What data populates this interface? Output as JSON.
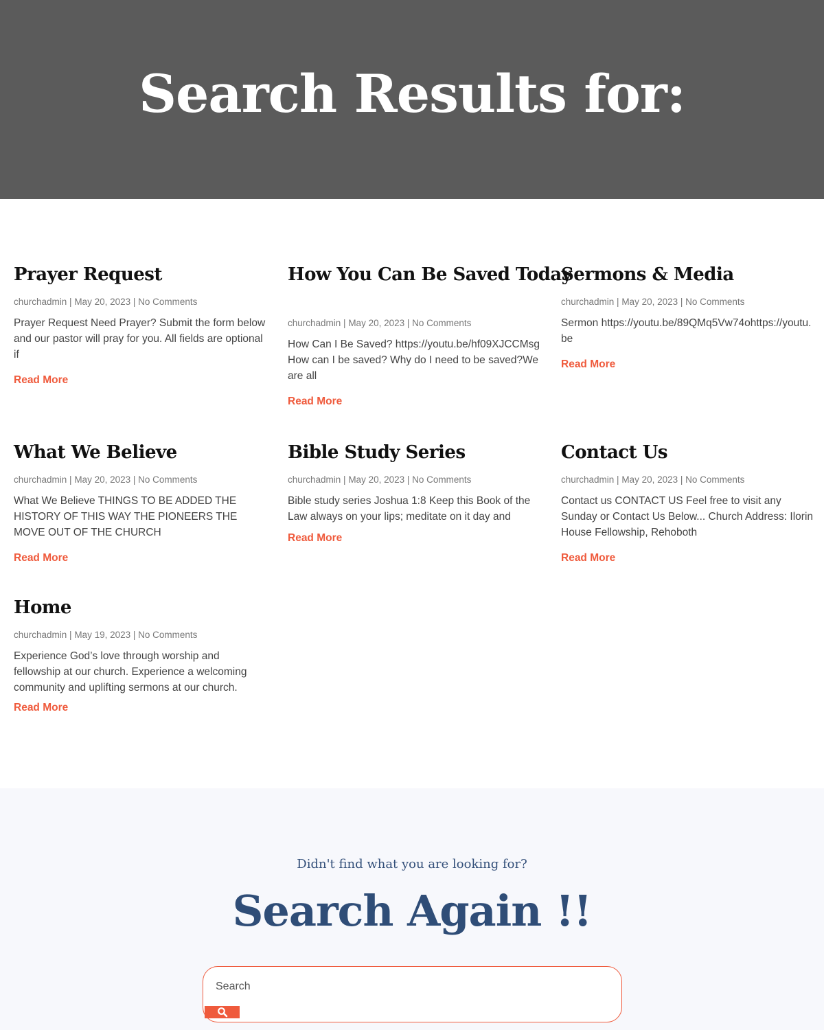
{
  "header": {
    "title": "Search Results for:"
  },
  "posts": [
    {
      "title": "Prayer Request",
      "author": "churchadmin",
      "date": "May 20, 2023",
      "comments": "No Comments",
      "excerpt": "Prayer Request Need Prayer? Submit the form below and our pastor will pray for you. All fields are optional if",
      "read_more": "Read More"
    },
    {
      "title": "How You Can Be Saved Today",
      "author": "churchadmin",
      "date": "May 20, 2023",
      "comments": "No Comments",
      "excerpt": "How Can I Be Saved? https://youtu.be/hf09XJCCMsg How can I be saved? Why do I need to be saved?We are all",
      "read_more": "Read More"
    },
    {
      "title": "Sermons & Media",
      "author": "churchadmin",
      "date": "May 20, 2023",
      "comments": "No Comments",
      "excerpt": "Sermon https://youtu.be/89QMq5Vw74ohttps://youtu.be",
      "read_more": "Read More"
    },
    {
      "title": "What We Believe",
      "author": "churchadmin",
      "date": "May 20, 2023",
      "comments": "No Comments",
      "excerpt": "What We Believe THINGS TO BE ADDED THE HISTORY OF THIS WAY THE PIONEERS THE MOVE OUT OF THE CHURCH",
      "read_more": "Read More"
    },
    {
      "title": "Bible Study Series",
      "author": "churchadmin",
      "date": "May 20, 2023",
      "comments": "No Comments",
      "excerpt": "Bible study series Joshua 1:8 Keep this Book of the Law always on your lips; meditate on it day and",
      "read_more": "Read More"
    },
    {
      "title": "Contact Us",
      "author": "churchadmin",
      "date": "May 20, 2023",
      "comments": "No Comments",
      "excerpt": "Contact us CONTACT US Feel free to visit any Sunday or Contact Us Below... Church Address: Ilorin House Fellowship, Rehoboth",
      "read_more": "Read More"
    },
    {
      "title": "Home",
      "author": "churchadmin",
      "date": "May 19, 2023",
      "comments": "No Comments",
      "excerpt": "Experience God’s love through worship and fellowship at our church. Experience a welcoming community and uplifting sermons at our church.",
      "read_more": "Read More"
    }
  ],
  "search_again": {
    "subheading": "Didn't find what you are looking for?",
    "heading": "Search Again !!",
    "placeholder": "Search",
    "button_icon": "search-icon"
  },
  "colors": {
    "hero_bg": "#5b5b5b",
    "accent": "#ef5a3c",
    "heading_blue": "#2f4d77",
    "section_bg": "#f7f8fc"
  }
}
